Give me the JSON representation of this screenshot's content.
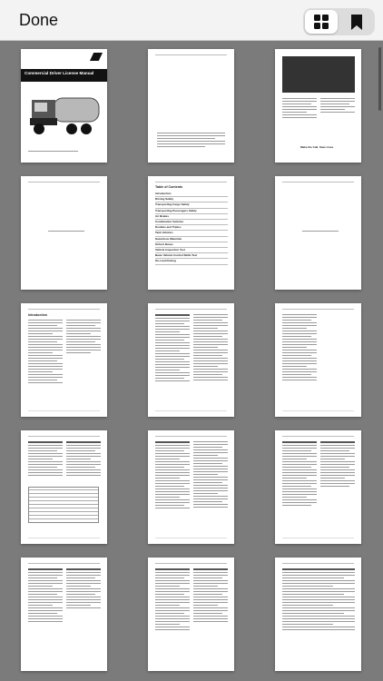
{
  "toolbar": {
    "done_label": "Done",
    "view_modes": [
      {
        "name": "grid",
        "icon": "grid-icon",
        "selected": true
      },
      {
        "name": "bookmarks",
        "icon": "bookmark-icon",
        "selected": false
      }
    ]
  },
  "document": {
    "cover_title": "Commercial Driver License Manual",
    "toc_title": "Table of Contents",
    "toc_entries": [
      "Introduction",
      "Driving Safely",
      "Transporting Cargo Safely",
      "Transporting Passengers Safely",
      "Air Brakes",
      "Combination Vehicles",
      "Doubles and Triples",
      "Tank Vehicles",
      "Hazardous Materials",
      "School Buses",
      "Vehicle Inspection Test",
      "Basic Vehicle Control Skills Test",
      "On-road Driving"
    ],
    "page3_caption": "Make the Call, Save Lives",
    "page7_heading": "Introduction"
  },
  "colors": {
    "background": "#7b7b7b",
    "toolbar": "#f3f3f3",
    "page": "#ffffff"
  }
}
